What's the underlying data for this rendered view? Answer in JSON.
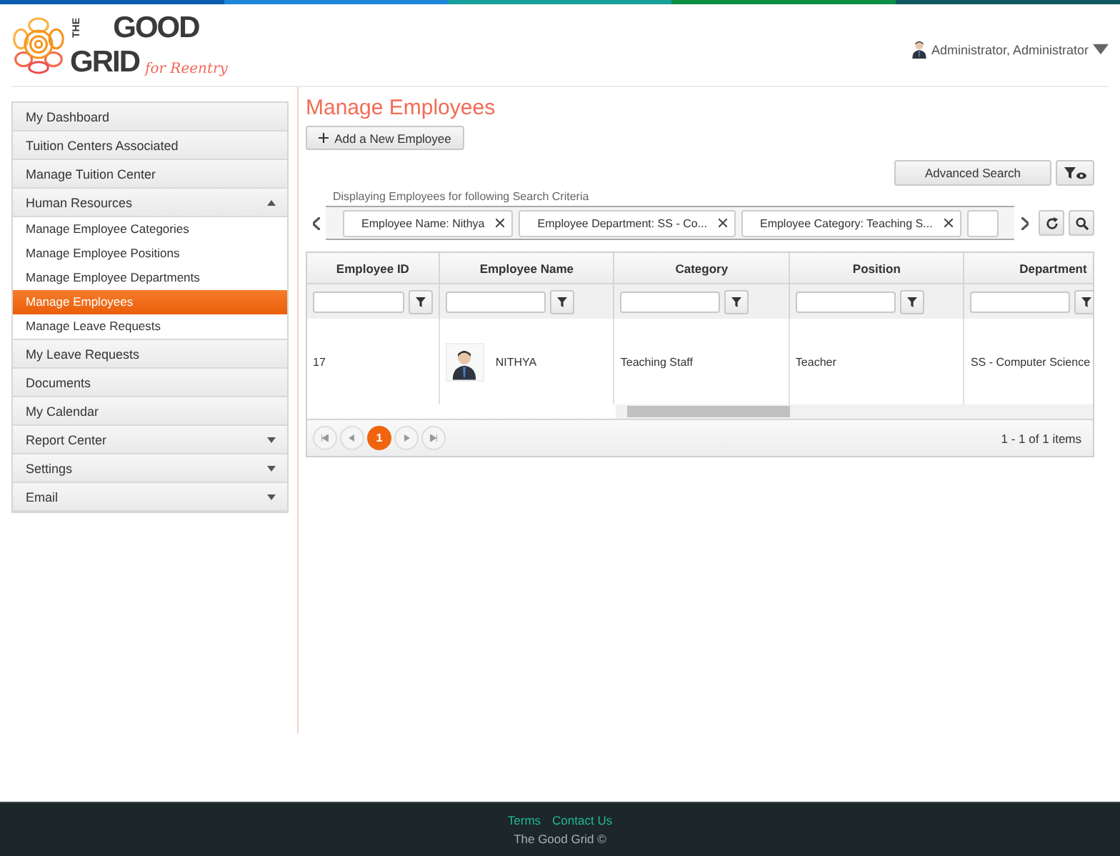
{
  "header": {
    "logo": {
      "line_1": "THE",
      "line_2": "GOOD",
      "line_3": "GRID",
      "tagline": "for Reentry"
    },
    "user": "Administrator, Administrator"
  },
  "sidebar": {
    "items": [
      {
        "kind": "link",
        "label": "My Dashboard"
      },
      {
        "kind": "link",
        "label": "Tuition Centers Associated"
      },
      {
        "kind": "link",
        "label": "Manage Tuition Center"
      },
      {
        "kind": "group",
        "label": "Human Resources",
        "expanded": true,
        "children": [
          {
            "label": "Manage Employee Categories",
            "selected": false
          },
          {
            "label": "Manage Employee Positions",
            "selected": false
          },
          {
            "label": "Manage Employee Departments",
            "selected": false
          },
          {
            "label": "Manage Employees",
            "selected": true
          },
          {
            "label": "Manage Leave Requests",
            "selected": false
          }
        ]
      },
      {
        "kind": "link",
        "label": "My Leave Requests"
      },
      {
        "kind": "link",
        "label": "Documents"
      },
      {
        "kind": "link",
        "label": "My Calendar"
      },
      {
        "kind": "group",
        "label": "Report Center",
        "expanded": false
      },
      {
        "kind": "group",
        "label": "Settings",
        "expanded": false
      },
      {
        "kind": "group",
        "label": "Email",
        "expanded": false
      }
    ]
  },
  "page": {
    "title": "Manage Employees",
    "add_button": "Add a New Employee",
    "advanced_search_button": "Advanced Search",
    "criteria_caption": "Displaying Employees for following Search Criteria",
    "criteria": [
      {
        "label": "Employee Name: Nithya"
      },
      {
        "label": "Employee Department: SS - Co..."
      },
      {
        "label": "Employee Category: Teaching S..."
      }
    ]
  },
  "grid": {
    "columns": [
      "Employee ID",
      "Employee Name",
      "Category",
      "Position",
      "Department"
    ],
    "rows": [
      {
        "cells": [
          "17",
          "NITHYA",
          "Teaching Staff",
          "Teacher",
          "SS - Computer Science"
        ]
      }
    ],
    "pages": [
      {
        "label": "1",
        "selected": true
      }
    ],
    "summary": "1 - 1 of 1 items"
  },
  "footer": {
    "links": [
      "Terms",
      "Contact Us"
    ],
    "copyright": "The Good Grid ©"
  }
}
